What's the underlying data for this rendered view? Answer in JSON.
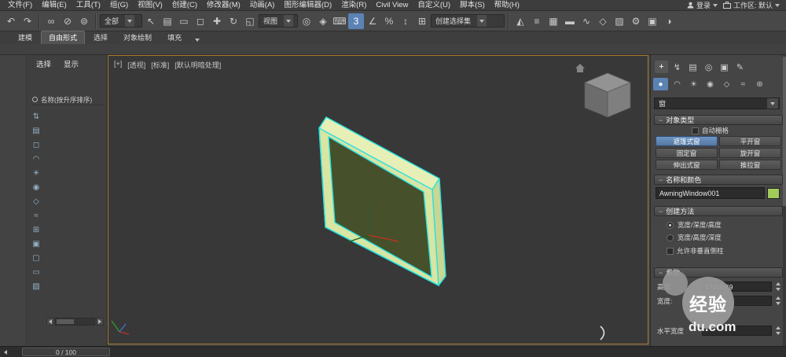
{
  "colors": {
    "accent": "#5a83b4",
    "selection": "#25e0e0",
    "viewport_border": "#a87a2e",
    "object_frame": "#d8e5a3",
    "object_glass": "#46512b",
    "name_swatch": "#a2cb5a"
  },
  "menu_bar": {
    "items": [
      {
        "name": "menu-file",
        "label": "文件(F)"
      },
      {
        "name": "menu-edit",
        "label": "编辑(E)"
      },
      {
        "name": "menu-tools",
        "label": "工具(T)"
      },
      {
        "name": "menu-group",
        "label": "组(G)"
      },
      {
        "name": "menu-views",
        "label": "视图(V)"
      },
      {
        "name": "menu-create",
        "label": "创建(C)"
      },
      {
        "name": "menu-modifiers",
        "label": "修改器(M)"
      },
      {
        "name": "menu-animation",
        "label": "动画(A)"
      },
      {
        "name": "menu-graph-editors",
        "label": "图形编辑器(D)"
      },
      {
        "name": "menu-rendering",
        "label": "渲染(R)"
      },
      {
        "name": "menu-civil-view",
        "label": "Civil View"
      },
      {
        "name": "menu-customize",
        "label": "自定义(U)"
      },
      {
        "name": "menu-scripting",
        "label": "脚本(S)"
      },
      {
        "name": "menu-help",
        "label": "帮助(H)"
      }
    ],
    "signin": "登录",
    "workspace": "工作区: 默认"
  },
  "toolbar": {
    "group1": [
      {
        "name": "undo-icon",
        "glyph": "↶"
      },
      {
        "name": "redo-icon",
        "glyph": "↷"
      }
    ],
    "group2": [
      {
        "name": "select-link-icon",
        "glyph": "∞"
      },
      {
        "name": "unlink-icon",
        "glyph": "⊘"
      },
      {
        "name": "bind-spacewarp-icon",
        "glyph": "⊚"
      }
    ],
    "selection_filter": {
      "value": "全部"
    },
    "group3": [
      {
        "name": "select-object-icon",
        "glyph": "↖"
      },
      {
        "name": "select-by-name-icon",
        "glyph": "▤"
      },
      {
        "name": "rect-select-region-icon",
        "glyph": "▭"
      },
      {
        "name": "window-crossing-icon",
        "glyph": "◻"
      },
      {
        "name": "select-move-icon",
        "glyph": "✚"
      },
      {
        "name": "select-rotate-icon",
        "glyph": "↻"
      },
      {
        "name": "select-scale-icon",
        "glyph": "◱"
      }
    ],
    "ref_coord": {
      "value": "视图"
    },
    "group4": [
      {
        "name": "use-pivot-center-icon",
        "glyph": "◎"
      },
      {
        "name": "select-manipulate-icon",
        "glyph": "◈"
      },
      {
        "name": "keyboard-override-icon",
        "glyph": "⌨"
      },
      {
        "name": "snap-toggle-3d-icon",
        "glyph": "3",
        "active": true
      },
      {
        "name": "angle-snap-icon",
        "glyph": "∠"
      },
      {
        "name": "percent-snap-icon",
        "glyph": "%"
      },
      {
        "name": "spinner-snap-icon",
        "glyph": "↕"
      },
      {
        "name": "edit-named-selections-icon",
        "glyph": "⊞"
      }
    ],
    "named_selection": {
      "value": "创建选择集"
    },
    "group5": [
      {
        "name": "mirror-icon",
        "glyph": "◭"
      },
      {
        "name": "align-icon",
        "glyph": "≡"
      },
      {
        "name": "layer-explorer-icon",
        "glyph": "▦"
      },
      {
        "name": "ribbon-toggle-icon",
        "glyph": "▬"
      },
      {
        "name": "curve-editor-icon",
        "glyph": "∿"
      },
      {
        "name": "schematic-view-icon",
        "glyph": "◇"
      },
      {
        "name": "material-editor-icon",
        "glyph": "▨"
      },
      {
        "name": "render-setup-icon",
        "glyph": "⚙"
      },
      {
        "name": "rendered-frame-icon",
        "glyph": "▣"
      },
      {
        "name": "render-production-icon",
        "glyph": "◑"
      }
    ]
  },
  "ribbon": {
    "tabs": [
      {
        "name": "ribbon-tab-modeling",
        "label": "建模"
      },
      {
        "name": "ribbon-tab-freeform",
        "label": "自由形式",
        "active": true
      },
      {
        "name": "ribbon-tab-selection",
        "label": "选择"
      },
      {
        "name": "ribbon-tab-object-paint",
        "label": "对象绘制"
      },
      {
        "name": "ribbon-tab-populate",
        "label": "填充"
      }
    ]
  },
  "scene_explorer": {
    "menus": [
      {
        "name": "explorer-menu-select",
        "label": "选择"
      },
      {
        "name": "explorer-menu-display",
        "label": "显示"
      }
    ],
    "column_header": "名称(按升序排序)",
    "tools": [
      {
        "name": "explorer-sort-icon",
        "glyph": "⇅"
      },
      {
        "name": "explorer-hierarchy-icon",
        "glyph": "▤"
      },
      {
        "name": "explorer-filter-geometry-icon",
        "glyph": "◻"
      },
      {
        "name": "explorer-filter-shapes-icon",
        "glyph": "◠"
      },
      {
        "name": "explorer-filter-lights-icon",
        "glyph": "☀"
      },
      {
        "name": "explorer-filter-cameras-icon",
        "glyph": "◉"
      },
      {
        "name": "explorer-filter-helpers-icon",
        "glyph": "◇"
      },
      {
        "name": "explorer-filter-spacewarps-icon",
        "glyph": "≈"
      },
      {
        "name": "explorer-filter-groups-icon",
        "glyph": "⊞"
      },
      {
        "name": "explorer-filter-xrefs-icon",
        "glyph": "▣"
      },
      {
        "name": "explorer-filter-bones-icon",
        "glyph": "▢"
      },
      {
        "name": "explorer-filter-containers-icon",
        "glyph": "▭"
      },
      {
        "name": "explorer-filter-materials-icon",
        "glyph": "▨"
      }
    ]
  },
  "viewport": {
    "menu": [
      {
        "name": "viewport-general-menu",
        "label": "[+]"
      },
      {
        "name": "viewport-pov-menu",
        "label": "[透视]"
      },
      {
        "name": "viewport-standard-menu",
        "label": "[标准]"
      },
      {
        "name": "viewport-shading-menu",
        "label": "[默认明暗处理]"
      }
    ]
  },
  "command_panel": {
    "tabs": [
      {
        "name": "create-tab-icon",
        "glyph": "+",
        "active": true
      },
      {
        "name": "modify-tab-icon",
        "glyph": "↯"
      },
      {
        "name": "hierarchy-tab-icon",
        "glyph": "▤"
      },
      {
        "name": "motion-tab-icon",
        "glyph": "◎"
      },
      {
        "name": "display-tab-icon",
        "glyph": "▣"
      },
      {
        "name": "utilities-tab-icon",
        "glyph": "✎"
      }
    ],
    "categories": [
      {
        "name": "category-geometry-icon",
        "glyph": "●",
        "active": true
      },
      {
        "name": "category-shapes-icon",
        "glyph": "◠"
      },
      {
        "name": "category-lights-icon",
        "glyph": "☀"
      },
      {
        "name": "category-cameras-icon",
        "glyph": "◉"
      },
      {
        "name": "category-helpers-icon",
        "glyph": "◇"
      },
      {
        "name": "category-spacewarps-icon",
        "glyph": "≈"
      },
      {
        "name": "category-systems-icon",
        "glyph": "⊛"
      }
    ],
    "subcategory": {
      "value": "窗"
    },
    "object_type": {
      "title": "对象类型",
      "autogrid_label": "自动栅格",
      "buttons": [
        {
          "name": "awning-window-button",
          "label": "遮篷式窗",
          "active": true
        },
        {
          "name": "casement-window-button",
          "label": "平开窗"
        },
        {
          "name": "fixed-window-button",
          "label": "固定窗"
        },
        {
          "name": "pivoted-window-button",
          "label": "旋开窗"
        },
        {
          "name": "projected-window-button",
          "label": "伸出式窗"
        },
        {
          "name": "sliding-window-button",
          "label": "推拉窗"
        }
      ]
    },
    "name_color": {
      "title": "名称和颜色",
      "name_value": "AwningWindow001"
    },
    "creation_method": {
      "title": "创建方法",
      "radio1": "宽度/深度/高度",
      "radio2": "宽度/高度/深度",
      "checkbox": "允许非垂直侧柱"
    },
    "parameters": {
      "title": "参数",
      "rows": [
        {
          "label": "高度:",
          "value": "17410.69"
        },
        {
          "label": "宽度:",
          "value": ""
        },
        {
          "label": "水平宽度",
          "value": ""
        }
      ]
    }
  },
  "watermark": {
    "badge": "经验",
    "domain": "du.com"
  },
  "status_bar": {
    "track": "0 / 100"
  }
}
